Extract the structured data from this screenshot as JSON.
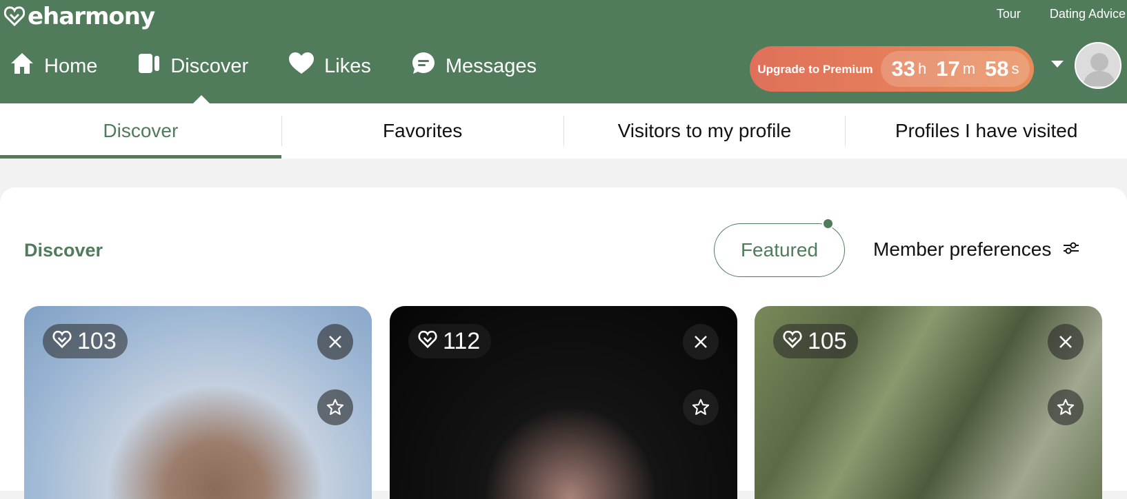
{
  "header": {
    "logo_text": "eharmony",
    "top_links": [
      "Tour",
      "Dating Advice"
    ],
    "nav": [
      {
        "label": "Home",
        "icon": "home-icon"
      },
      {
        "label": "Discover",
        "icon": "cards-icon"
      },
      {
        "label": "Likes",
        "icon": "heart-icon"
      },
      {
        "label": "Messages",
        "icon": "chat-icon"
      }
    ],
    "upgrade_label": "Upgrade to Premium",
    "timer": {
      "hours": "33",
      "hours_unit": "h",
      "minutes": "17",
      "minutes_unit": "m",
      "seconds": "58",
      "seconds_unit": "s"
    }
  },
  "subtabs": [
    "Discover",
    "Favorites",
    "Visitors to my profile",
    "Profiles I have visited"
  ],
  "main": {
    "title": "Discover",
    "featured_label": "Featured",
    "preferences_label": "Member preferences"
  },
  "cards": [
    {
      "score": "103"
    },
    {
      "score": "112"
    },
    {
      "score": "105"
    }
  ],
  "colors": {
    "brand_green": "#507c5c",
    "upgrade_orange": "#e0705a"
  }
}
